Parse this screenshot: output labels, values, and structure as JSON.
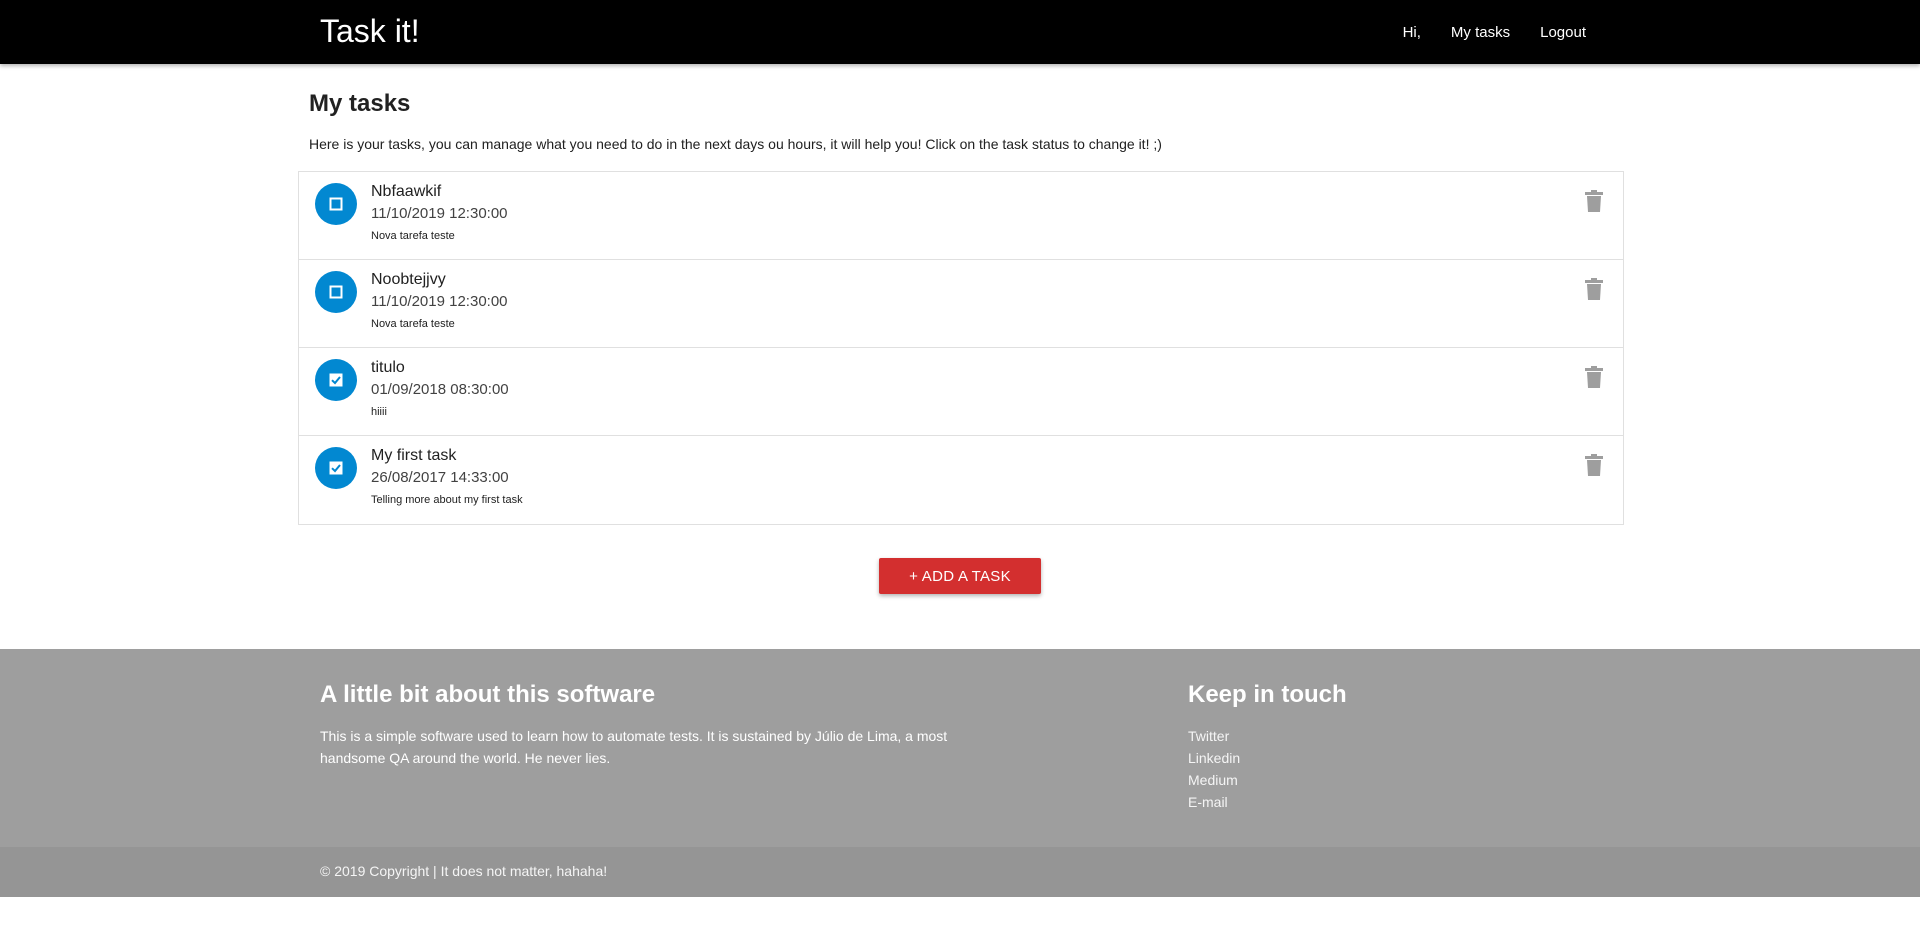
{
  "colors": {
    "navbar": "#000000",
    "status_button": "#0288d1",
    "add_button": "#d32f2f",
    "footer": "#9e9e9e",
    "copyright_bar": "#959595",
    "delete_icon": "#9e9e9e"
  },
  "navbar": {
    "brand": "Task it!",
    "links": {
      "greeting": "Hi,",
      "my_tasks": "My tasks",
      "logout": "Logout"
    }
  },
  "main": {
    "title": "My tasks",
    "description": "Here is your tasks, you can manage what you need to do in the next days ou hours, it will help you! Click on the task status to change it! ;)",
    "tasks": [
      {
        "title": "Nbfaawkif",
        "date": "11/10/2019 12:30:00",
        "description": "Nova tarefa teste",
        "done": false,
        "status_icon": "checkbox-empty-icon",
        "delete_icon": "trash-icon"
      },
      {
        "title": "Noobtejjvy",
        "date": "11/10/2019 12:30:00",
        "description": "Nova tarefa teste",
        "done": false,
        "status_icon": "checkbox-empty-icon",
        "delete_icon": "trash-icon"
      },
      {
        "title": "titulo",
        "date": "01/09/2018 08:30:00",
        "description": "hiiii",
        "done": true,
        "status_icon": "checkbox-checked-icon",
        "delete_icon": "trash-icon"
      },
      {
        "title": "My first task",
        "date": "26/08/2017 14:33:00",
        "description": "Telling more about my first task",
        "done": true,
        "status_icon": "checkbox-checked-icon",
        "delete_icon": "trash-icon"
      }
    ],
    "add_button_label": "+ ADD A TASK"
  },
  "footer": {
    "about_title": "A little bit about this software",
    "about_text": "This is a simple software used to learn how to automate tests. It is sustained by Júlio de Lima, a most handsome QA around the world. He never lies.",
    "touch_title": "Keep in touch",
    "links": [
      "Twitter",
      "Linkedin",
      "Medium",
      "E-mail"
    ],
    "copyright": "© 2019 Copyright | It does not matter, hahaha!"
  }
}
